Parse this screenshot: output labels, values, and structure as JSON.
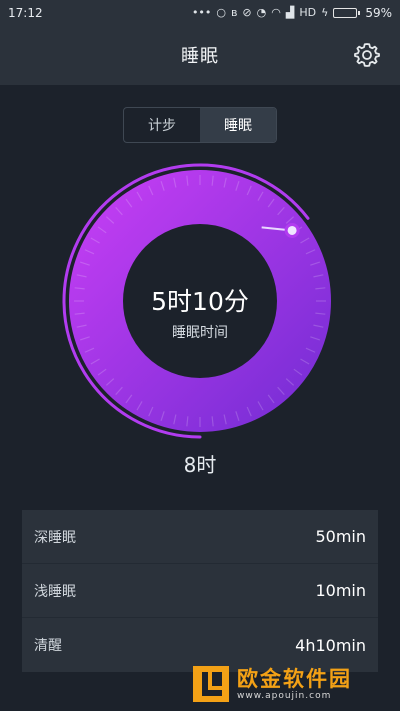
{
  "status_bar": {
    "time": "17:12",
    "network": "HD",
    "battery": "59%",
    "battery_level": 0.59,
    "icons": [
      "notification-dots-icon",
      "circle-icon",
      "bluetooth-icon",
      "silent-icon",
      "alarm-icon",
      "wifi-icon",
      "signal-icon",
      "charging-icon"
    ]
  },
  "header": {
    "title": "睡眠",
    "settings_icon": "gear-icon"
  },
  "tabs": [
    {
      "label": "计步",
      "active": false
    },
    {
      "label": "睡眠",
      "active": true
    }
  ],
  "ring": {
    "time_value": "5时10分",
    "label": "睡眠时间",
    "progress": 0.646,
    "colors": {
      "start": "#c13df2",
      "end": "#7a2ed6",
      "track": "#1c222b"
    }
  },
  "goal": "8时",
  "stats": [
    {
      "label": "深睡眠",
      "value": "50min"
    },
    {
      "label": "浅睡眠",
      "value": "10min"
    },
    {
      "label": "清醒",
      "value": "4h10min"
    }
  ],
  "watermark": {
    "title": "欧金软件园",
    "url": "www.apoujin.com"
  }
}
